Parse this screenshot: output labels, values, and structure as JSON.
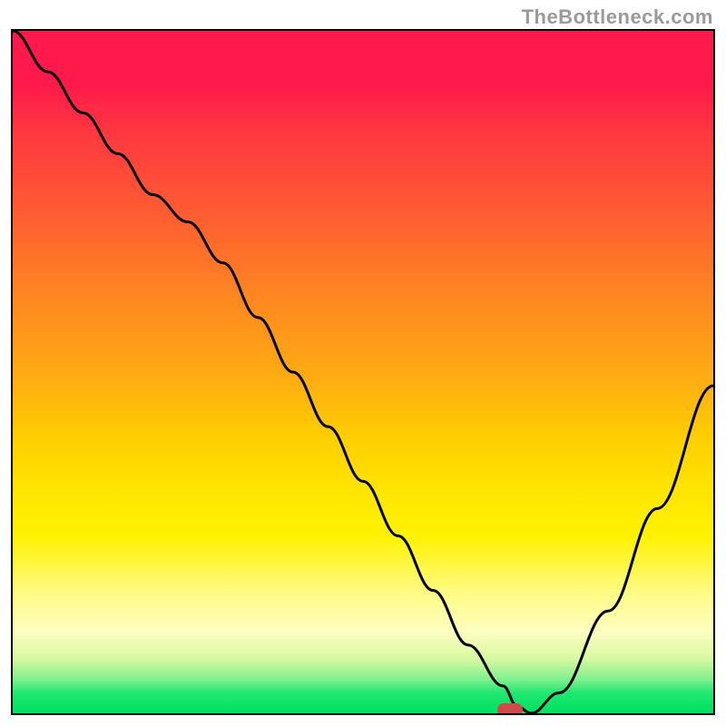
{
  "watermark": "TheBottleneck.com",
  "chart_data": {
    "type": "line",
    "title": "",
    "xlabel": "",
    "ylabel": "",
    "xlim": [
      0,
      100
    ],
    "ylim": [
      0,
      100
    ],
    "grid": false,
    "legend": false,
    "background": "rainbow-gradient-vertical",
    "gradient_colors_top_to_bottom": [
      "#ff1a4b",
      "#ff3840",
      "#ff6030",
      "#ff8a20",
      "#ffb010",
      "#ffd000",
      "#ffe600",
      "#fff200",
      "#fffb80",
      "#fdfec0",
      "#d8f8a0",
      "#80f090",
      "#20e870",
      "#00e060"
    ],
    "series": [
      {
        "name": "bottleneck-curve",
        "x": [
          0,
          5,
          10,
          15,
          20,
          25,
          30,
          35,
          40,
          45,
          50,
          55,
          60,
          65,
          70,
          72,
          74,
          78,
          85,
          92,
          100
        ],
        "y": [
          100,
          94,
          88,
          82,
          76,
          72,
          66,
          58,
          50,
          42,
          34,
          26,
          18,
          10,
          4,
          1,
          0,
          3,
          15,
          30,
          48
        ]
      }
    ],
    "marker": {
      "name": "sweet-spot-pill",
      "x": 71,
      "y": 0.5,
      "color": "#d14a4a",
      "shape": "rounded-rect"
    }
  }
}
